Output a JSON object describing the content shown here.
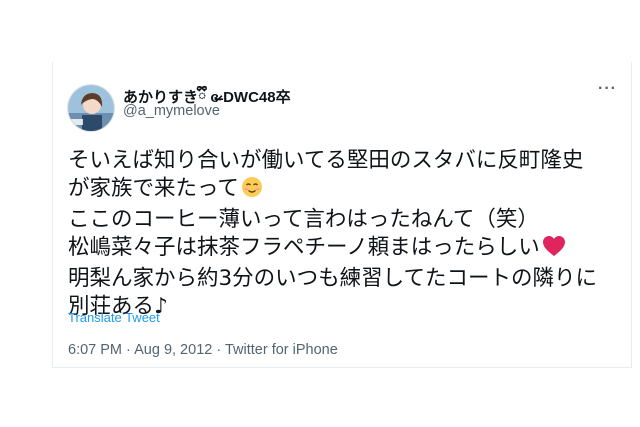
{
  "tweet": {
    "display_name": "あかりすきྀི ɞ̴̶̷ DWC48卒",
    "handle": "@a_mymelove",
    "body_lines": [
      "そいえば知り合いが働いてる堅田のスタバに反町隆史",
      "が家族で来たって",
      "ここのコーヒー薄いって言わはったねんて（笑）",
      "松嶋菜々子は抹茶フラペチーノ頼まはったらしい",
      "明梨ん家から約3分のいつも練習してたコートの隣りに",
      "別荘ある♪"
    ],
    "translate_label": "Translate Tweet",
    "time": "6:07 PM",
    "separator": "·",
    "date": "Aug 9, 2012",
    "source": "Twitter for iPhone",
    "more_icon": "···",
    "emoji_line2": "smiling-face-icon",
    "emoji_line4": "red-heart-icon"
  },
  "colors": {
    "text": "#0f1419",
    "secondary": "#536471",
    "link": "#1d9bf0",
    "heart": "#e0245e",
    "smile": "#fdcb58"
  }
}
